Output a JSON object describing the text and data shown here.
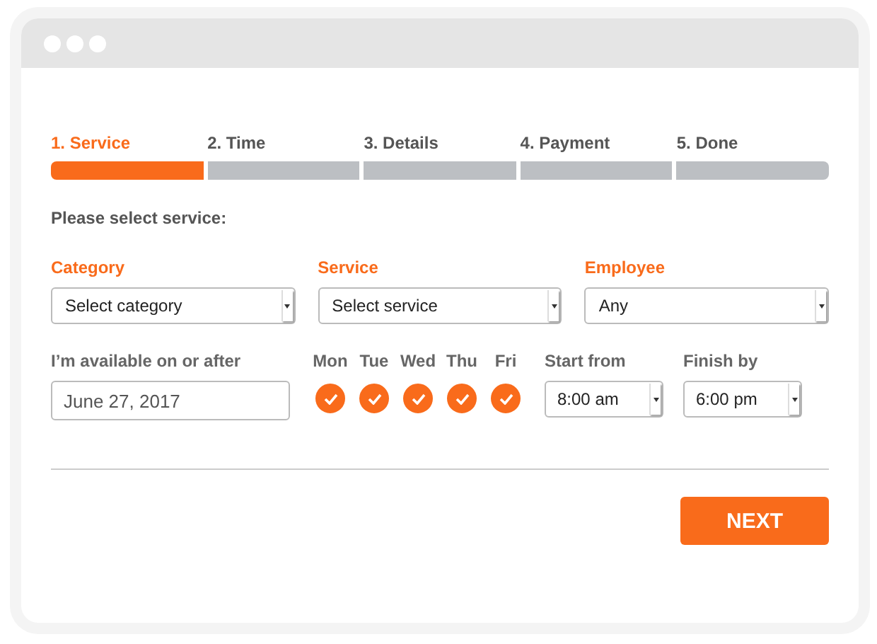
{
  "steps": [
    {
      "label": "1. Service",
      "selected": true
    },
    {
      "label": "2. Time",
      "selected": false
    },
    {
      "label": "3. Details",
      "selected": false
    },
    {
      "label": "4. Payment",
      "selected": false
    },
    {
      "label": "5. Done",
      "selected": false
    }
  ],
  "prompt": "Please select service:",
  "selects": [
    {
      "label": "Category",
      "value": "Select category"
    },
    {
      "label": "Service",
      "value": "Select service"
    },
    {
      "label": "Employee",
      "value": "Any"
    }
  ],
  "date": {
    "label": "I’m available on or after",
    "value": "June 27, 2017"
  },
  "days": [
    {
      "label": "Mon",
      "checked": true
    },
    {
      "label": "Tue",
      "checked": true
    },
    {
      "label": "Wed",
      "checked": true
    },
    {
      "label": "Thu",
      "checked": true
    },
    {
      "label": "Fri",
      "checked": true
    }
  ],
  "start": {
    "label": "Start from",
    "value": "8:00 am"
  },
  "finish": {
    "label": "Finish by",
    "value": "6:00 pm"
  },
  "next_button": "NEXT"
}
